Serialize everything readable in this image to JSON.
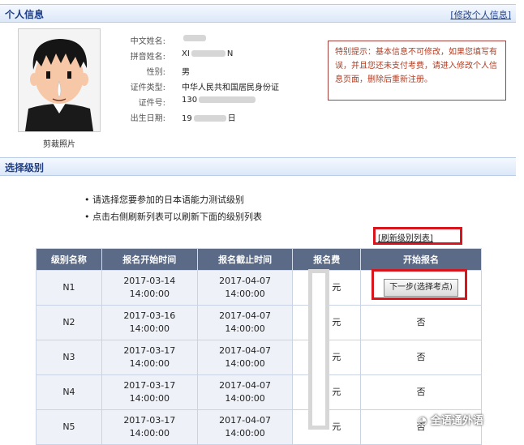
{
  "personal": {
    "section_title": "个人信息",
    "edit_link": "[修改个人信息]",
    "photo_caption": "剪裁照片",
    "rows": [
      {
        "label": "中文姓名:",
        "value": ""
      },
      {
        "label": "拼音姓名:",
        "value": "XI",
        "value_tail": "N"
      },
      {
        "label": "性别:",
        "value": "男"
      },
      {
        "label": "证件类型:",
        "value": "中华人民共和国居民身份证"
      },
      {
        "label": "证件号:",
        "value": "130"
      },
      {
        "label": "出生日期:",
        "value": "19",
        "value_tail": "日"
      }
    ],
    "notice": "特别提示：基本信息不可修改，如果您填写有误，并且您还未支付考费，请进入修改个人信息页面，删除后重新注册。"
  },
  "level": {
    "section_title": "选择级别",
    "bullets": [
      "请选择您要参加的日本语能力测试级别",
      "点击右侧刷新列表可以刷新下面的级别列表"
    ],
    "refresh_link": "[刷新级别列表]",
    "columns": [
      "级别名称",
      "报名开始时间",
      "报名截止时间",
      "报名费",
      "开始报名"
    ],
    "rows": [
      {
        "level": "N1",
        "start_date": "2017-03-14",
        "start_time": "14:00:00",
        "end_date": "2017-04-07",
        "end_time": "14:00:00",
        "fee": "元",
        "action": "下一步(选择考点)",
        "has_button": true
      },
      {
        "level": "N2",
        "start_date": "2017-03-16",
        "start_time": "14:00:00",
        "end_date": "2017-04-07",
        "end_time": "14:00:00",
        "fee": "元",
        "action": "否",
        "has_button": false
      },
      {
        "level": "N3",
        "start_date": "2017-03-17",
        "start_time": "14:00:00",
        "end_date": "2017-04-07",
        "end_time": "14:00:00",
        "fee": "元",
        "action": "否",
        "has_button": false
      },
      {
        "level": "N4",
        "start_date": "2017-03-17",
        "start_time": "14:00:00",
        "end_date": "2017-04-07",
        "end_time": "14:00:00",
        "fee": "元",
        "action": "否",
        "has_button": false
      },
      {
        "level": "N5",
        "start_date": "2017-03-17",
        "start_time": "14:00:00",
        "end_date": "2017-04-07",
        "end_time": "14:00:00",
        "fee": "元",
        "action": "否",
        "has_button": false
      }
    ]
  },
  "watermark": "全语通外语",
  "colors": {
    "header_text": "#1f3f86",
    "table_header": "#5b6a86",
    "highlight": "#d8141c",
    "notice": "#b43c20"
  }
}
